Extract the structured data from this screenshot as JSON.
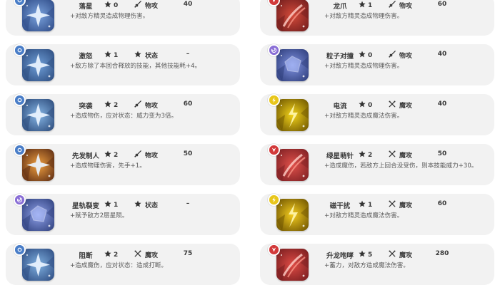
{
  "skills_left": [
    {
      "name": "落星",
      "cost": "0",
      "category": "物攻",
      "power": "40",
      "desc": "+对敌方精灵造成物理伤害。",
      "attribute": "normal",
      "category_icon": "physical-attack-icon",
      "art_colors": [
        "#2e4a86",
        "#7aa3de"
      ]
    },
    {
      "name": "激怒",
      "cost": "1",
      "category": "状态",
      "power": "–",
      "desc": "+敌方除了本回合释放的技能，其他技能耗+4。",
      "attribute": "normal",
      "category_icon": "status-icon",
      "art_colors": [
        "#2c4b7e",
        "#6f9fd8"
      ]
    },
    {
      "name": "突袭",
      "cost": "2",
      "category": "物攻",
      "power": "60",
      "desc": "+造成物伤，应对状态：威力变为3倍。",
      "attribute": "normal",
      "category_icon": "physical-attack-icon",
      "art_colors": [
        "#2a4878",
        "#86b6e6"
      ]
    },
    {
      "name": "先发制人",
      "cost": "2",
      "category": "物攻",
      "power": "50",
      "desc": "+造成物理伤害，先手+1。",
      "attribute": "normal",
      "category_icon": "physical-attack-icon",
      "art_colors": [
        "#5a2a12",
        "#f0a040"
      ]
    },
    {
      "name": "星轨裂变",
      "cost": "1",
      "category": "状态",
      "power": "–",
      "desc": "+赋予敌方2层星陨。",
      "attribute": "cosmic",
      "category_icon": "status-icon",
      "art_colors": [
        "#2e3f7c",
        "#8ea0e8"
      ]
    },
    {
      "name": "阻断",
      "cost": "2",
      "category": "魔攻",
      "power": "75",
      "desc": "+造成魔伤，应对状态：造成打断。",
      "attribute": "normal",
      "category_icon": "magic-attack-icon",
      "art_colors": [
        "#2c4a80",
        "#7fb0e0"
      ]
    }
  ],
  "skills_right": [
    {
      "name": "龙爪",
      "cost": "1",
      "category": "物攻",
      "power": "60",
      "desc": "+对敌方精灵造成物理伤害。",
      "attribute": "dragon",
      "category_icon": "physical-attack-icon",
      "art_colors": [
        "#6e1c1c",
        "#d44a3a"
      ]
    },
    {
      "name": "粒子对撞",
      "cost": "0",
      "category": "物攻",
      "power": "40",
      "desc": "+对敌方精灵造成物理伤害。",
      "attribute": "cosmic",
      "category_icon": "physical-attack-icon",
      "art_colors": [
        "#2c3b78",
        "#7f92e0"
      ]
    },
    {
      "name": "电流",
      "cost": "0",
      "category": "魔攻",
      "power": "40",
      "desc": "+对敌方精灵造成魔法伤害。",
      "attribute": "electric",
      "category_icon": "magic-attack-icon",
      "art_colors": [
        "#6a5200",
        "#f2d21a"
      ]
    },
    {
      "name": "绿星萌针",
      "cost": "2",
      "category": "魔攻",
      "power": "50",
      "desc": "+造成魔伤，若敌方上回合没受伤，则本技能威力+30。",
      "attribute": "dragon",
      "category_icon": "magic-attack-icon",
      "art_colors": [
        "#7a1e22",
        "#e0504a"
      ]
    },
    {
      "name": "磁干扰",
      "cost": "1",
      "category": "魔攻",
      "power": "60",
      "desc": "+对敌方精灵造成魔法伤害。",
      "attribute": "electric",
      "category_icon": "magic-attack-icon",
      "art_colors": [
        "#6a5000",
        "#f4cc1e"
      ]
    },
    {
      "name": "升龙咆哮",
      "cost": "5",
      "category": "魔攻",
      "power": "280",
      "desc": "+蓄力，对敌方造成魔法伤害。",
      "attribute": "dragon",
      "category_icon": "magic-attack-icon",
      "art_colors": [
        "#741c1e",
        "#de4a44"
      ]
    }
  ],
  "attribute_colors": {
    "normal": "#4a7ec8",
    "cosmic": "#8a6fd6",
    "dragon": "#d2393a",
    "electric": "#e8c61a"
  },
  "icons": {
    "cost": "star-cost-icon",
    "physical": "sword-icon",
    "magic": "crossed-wands-icon",
    "status": "star-status-icon"
  }
}
